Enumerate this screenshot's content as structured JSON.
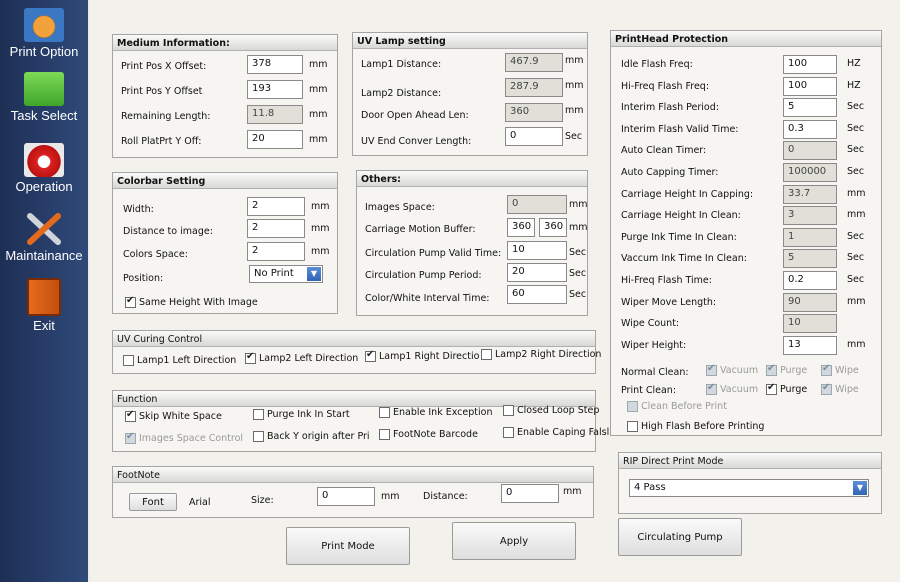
{
  "sidebar": {
    "items": [
      {
        "label": "Print Option",
        "icon": "gear-icon"
      },
      {
        "label": "Task Select",
        "icon": "folder-icon"
      },
      {
        "label": "Operation",
        "icon": "camera-icon"
      },
      {
        "label": "Maintainance",
        "icon": "wrench-icon"
      },
      {
        "label": "Exit",
        "icon": "exit-door-icon"
      }
    ]
  },
  "medium": {
    "title": "Medium Information:",
    "rows": [
      {
        "label": "Print Pos X Offset:",
        "value": "378",
        "unit": "mm"
      },
      {
        "label": "Print Pos Y Offset",
        "value": "193",
        "unit": "mm"
      },
      {
        "label": "Remaining Length:",
        "value": "11.8",
        "unit": "mm"
      },
      {
        "label": "Roll PlatPrt Y Off:",
        "value": "20",
        "unit": "mm"
      }
    ]
  },
  "uvlamp": {
    "title": "UV Lamp setting",
    "rows": [
      {
        "label": "Lamp1 Distance:",
        "value": "467.9",
        "unit": "mm"
      },
      {
        "label": "Lamp2 Distance:",
        "value": "287.9",
        "unit": "mm"
      },
      {
        "label": "Door Open Ahead Len:",
        "value": "360",
        "unit": "mm"
      },
      {
        "label": "UV End Conver Length:",
        "value": "0",
        "unit": "Sec"
      }
    ]
  },
  "printhead": {
    "title": "PrintHead Protection",
    "rows": [
      {
        "label": "Idle Flash Freq:",
        "value": "100",
        "unit": "HZ"
      },
      {
        "label": "Hi-Freq Flash Freq:",
        "value": "100",
        "unit": "HZ"
      },
      {
        "label": "Interim Flash Period:",
        "value": "5",
        "unit": "Sec"
      },
      {
        "label": "Interim Flash Valid Time:",
        "value": "0.3",
        "unit": "Sec"
      },
      {
        "label": "Auto Clean  Timer:",
        "value": "0",
        "unit": "Sec"
      },
      {
        "label": "Auto Capping Timer:",
        "value": "100000",
        "unit": "Sec"
      },
      {
        "label": "Carriage  Height In Capping:",
        "value": "33.7",
        "unit": "mm"
      },
      {
        "label": "Carriage Height  In Clean:",
        "value": "3",
        "unit": "mm"
      },
      {
        "label": "Purge Ink Time In Clean:",
        "value": "1",
        "unit": "Sec"
      },
      {
        "label": "Vaccum Ink Time In Clean:",
        "value": "5",
        "unit": "Sec"
      },
      {
        "label": "Hi-Freq Flash Time:",
        "value": "0.2",
        "unit": "Sec"
      },
      {
        "label": "Wiper Move Length:",
        "value": "90",
        "unit": "mm"
      },
      {
        "label": "Wipe Count:",
        "value": "10",
        "unit": ""
      },
      {
        "label": "Wiper Height:",
        "value": "13",
        "unit": "mm"
      }
    ],
    "normal_clean_label": "Normal Clean:",
    "print_clean_label": "Print Clean:",
    "vacuum": "Vacuum",
    "purge": "Purge",
    "wipe": "Wipe",
    "clean_before_print": "Clean Before Print",
    "high_flash": "High Flash Before Printing"
  },
  "colorbar": {
    "title": "Colorbar Setting",
    "rows": [
      {
        "label": "Width:",
        "value": "2",
        "unit": "mm"
      },
      {
        "label": "Distance to image:",
        "value": "2",
        "unit": "mm"
      },
      {
        "label": "Colors Space:",
        "value": "2",
        "unit": "mm"
      }
    ],
    "position_label": "Position:",
    "position_value": "No Print",
    "same_height": "Same Height With Image"
  },
  "others": {
    "title": "Others:",
    "images_space_label": "Images Space:",
    "images_space": "0",
    "images_space_unit": "mm",
    "carriage_label": "Carriage Motion  Buffer:",
    "carriage_1": "360",
    "carriage_2": "360",
    "carriage_unit": "mm",
    "pump_valid_label": "Circulation Pump Valid Time:",
    "pump_valid": "10",
    "pump_valid_unit": "Sec",
    "pump_period_label": "Circulation Pump Period:",
    "pump_period": "20",
    "pump_period_unit": "Sec",
    "interval_label": "Color/White Interval Time:",
    "interval": "60",
    "interval_unit": "Sec"
  },
  "uvcuring": {
    "title": "UV Curing Control",
    "items": [
      "Lamp1  Left Direction",
      "Lamp2  Left Direction",
      "Lamp1 Right Directio",
      "Lamp2 Right Direction"
    ]
  },
  "function": {
    "title": "Function",
    "skip_white": "Skip White Space",
    "images_space_control": "Images Space Control",
    "purge_start": "Purge Ink In Start",
    "back_y": "Back Y origin after Pri",
    "ink_exception": "Enable Ink Exception",
    "footnote_barcode": "FootNote Barcode",
    "closed_loop": "Closed Loop Step",
    "enable_caping": "Enable Caping  Falsl"
  },
  "footnote": {
    "title": "FootNote",
    "font_button": "Font",
    "font_name": "Arial",
    "size_label": "Size:",
    "size_value": "0",
    "size_unit": "mm",
    "distance_label": "Distance:",
    "distance_value": "0",
    "distance_unit": "mm"
  },
  "rip": {
    "title": "RIP Direct Print Mode",
    "value": "4 Pass"
  },
  "buttons": {
    "print_mode": "Print Mode",
    "apply": "Apply",
    "circulating_pump": "Circulating Pump"
  }
}
